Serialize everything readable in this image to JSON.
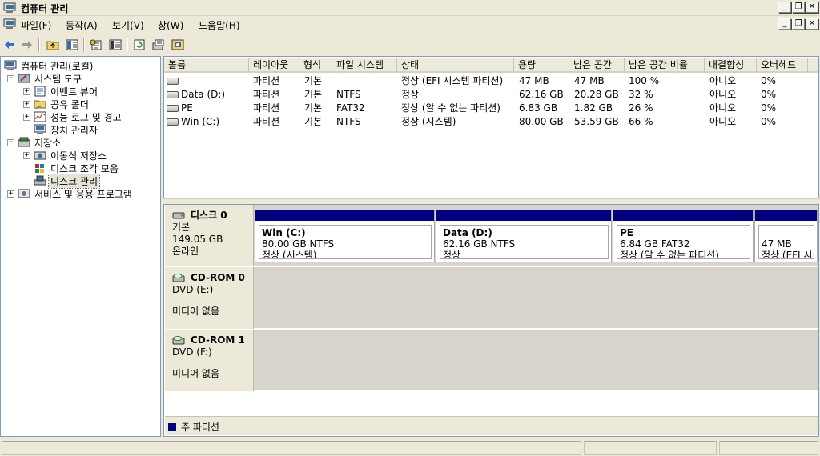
{
  "window": {
    "title": "컴퓨터 관리"
  },
  "menubar": {
    "items": [
      "파일(F)",
      "동작(A)",
      "보기(V)",
      "창(W)",
      "도움말(H)"
    ]
  },
  "toolbar": {
    "buttons": [
      "back-icon",
      "forward-icon",
      "up-folder-icon",
      "show-hide-tree-icon",
      "properties-icon",
      "help-icon",
      "refresh-icon",
      "export-icon",
      "disk-settings-icon"
    ]
  },
  "tree": {
    "root": "컴퓨터 관리(로컬)",
    "system_tools": "시스템 도구",
    "event_viewer": "이벤트 뷰어",
    "shared_folders": "공유 폴더",
    "perf_logs": "성능 로그 및 경고",
    "device_manager": "장치 관리자",
    "storage": "저장소",
    "removable_storage": "이동식 저장소",
    "defrag": "디스크 조각 모음",
    "disk_management": "디스크 관리",
    "services": "서비스 및 응용 프로그램"
  },
  "volume_list": {
    "columns": [
      "볼륨",
      "레이아웃",
      "형식",
      "파일 시스템",
      "상태",
      "용량",
      "남은 공간",
      "남은 공간 비율",
      "내결함성",
      "오버헤드"
    ],
    "rows": [
      [
        "",
        "파티션",
        "기본",
        "",
        "정상 (EFI 시스템 파티션)",
        "47 MB",
        "47 MB",
        "100 %",
        "아니오",
        "0%"
      ],
      [
        "Data (D:)",
        "파티션",
        "기본",
        "NTFS",
        "정상",
        "62.16 GB",
        "20.28 GB",
        "32 %",
        "아니오",
        "0%"
      ],
      [
        "PE",
        "파티션",
        "기본",
        "FAT32",
        "정상 (알 수 없는 파티션)",
        "6.83 GB",
        "1.82 GB",
        "26 %",
        "아니오",
        "0%"
      ],
      [
        "Win (C:)",
        "파티션",
        "기본",
        "NTFS",
        "정상 (시스템)",
        "80.00 GB",
        "53.59 GB",
        "66 %",
        "아니오",
        "0%"
      ]
    ]
  },
  "disks": [
    {
      "name": "디스크 0",
      "type": "기본",
      "size": "149.05 GB",
      "status": "온라인",
      "partitions": [
        {
          "name": "Win  (C:)",
          "size": "80.00 GB NTFS",
          "status": "정상 (시스템)"
        },
        {
          "name": "Data  (D:)",
          "size": "62.16 GB NTFS",
          "status": "정상"
        },
        {
          "name": "PE",
          "size": "6.84 GB FAT32",
          "status": "정상 (알 수 없는 파티션)"
        },
        {
          "name": "",
          "size": "47 MB",
          "status": "정상 (EFI 시스템 파티션)"
        }
      ]
    },
    {
      "name": "CD-ROM 0",
      "type": "DVD (E:)",
      "media": "미디어 없음"
    },
    {
      "name": "CD-ROM 1",
      "type": "DVD (F:)",
      "media": "미디어 없음"
    }
  ],
  "legend": {
    "primary_partition": "주 파티션",
    "primary_color": "#000080"
  }
}
